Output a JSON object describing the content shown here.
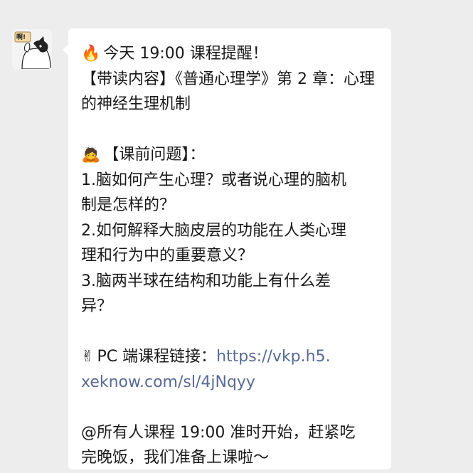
{
  "message": {
    "lines": {
      "l1": "今天 19:00 课程提醒！",
      "l2": "【带读内容】《普通心理学》第 2 章：心理",
      "l3": "的神经生理机制",
      "l4": "【课前问题】：",
      "l5": "1.脑如何产生心理？或者说心理的脑机",
      "l6": "制是怎样的？",
      "l7": "2.如何解释大脑皮层的功能在人类心理",
      "l8": "理和行为中的重要意义？",
      "l9": "3.脑两半球在结构和功能上有什么差",
      "l10": "异？",
      "l11_prefix": "PC 端课程链接：",
      "l11_link": "https://vkp.h5.",
      "l12_link": "xeknow.com/sl/4jNqyy",
      "l13": "@所有人课程 19:00 准时开始，赶紧吃",
      "l14": "完晚饭，我们准备上课啦～"
    },
    "emojis": {
      "fire": "🔥",
      "person": "🙇",
      "victory": "✌"
    }
  },
  "avatar": {
    "icon": "cat-avatar-icon",
    "sign_text": "啊!"
  }
}
